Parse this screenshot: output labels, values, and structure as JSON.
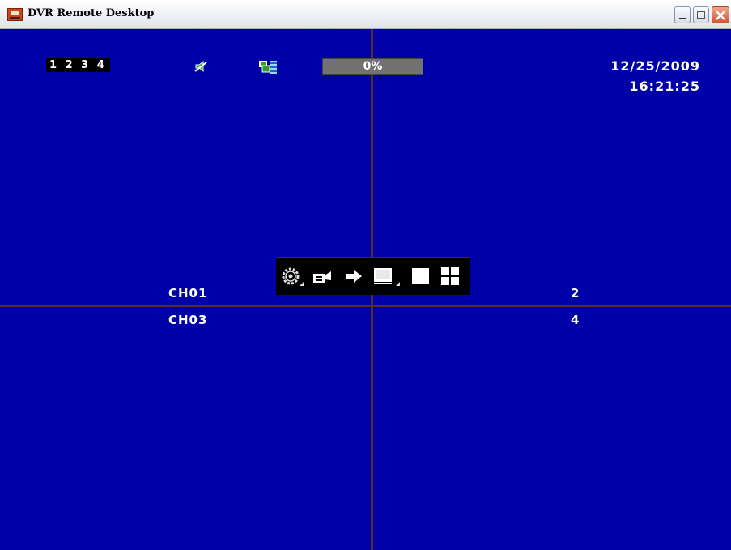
{
  "window": {
    "title": "DVR Remote Desktop"
  },
  "status": {
    "channel_indicator": "1 2 3 4",
    "progress_text": "0%",
    "progress_value": 0,
    "date": "12/25/2009",
    "time": "16:21:25"
  },
  "channels": {
    "ch1": "CH01",
    "ch2": "2",
    "ch3": "CH03",
    "ch4": "4"
  },
  "toolbar": {
    "icons": [
      "gear-icon",
      "camera-icon",
      "arrow-right-icon",
      "monitor-icon",
      "single-view-icon",
      "quad-view-icon"
    ]
  },
  "colors": {
    "background": "#0000a8",
    "divider": "#5a2e22",
    "osd_text": "#ffffff"
  }
}
